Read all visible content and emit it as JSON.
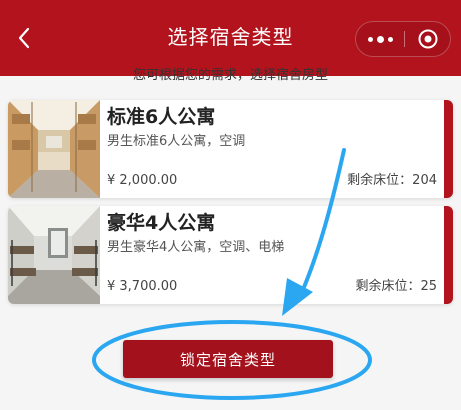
{
  "header": {
    "title": "选择宿舍类型",
    "back_icon": "chevron-left-icon",
    "more_icon": "more-dots-icon",
    "close_icon": "target-circle-icon",
    "background_color": "#b2131c"
  },
  "subtitle": "您可根据您的需求，选择宿舍房型",
  "rooms": [
    {
      "name": "标准6人公寓",
      "desc": "男生标准6人公寓，空调",
      "price": "¥ 2,000.00",
      "beds": "剩余床位：204"
    },
    {
      "name": "豪华4人公寓",
      "desc": "男生豪华4人公寓，空调、电梯",
      "price": "¥ 3,700.00",
      "beds": "剩余床位：25"
    }
  ],
  "lock_button_label": "锁定宿舍类型",
  "accent_color": "#b2131c",
  "annotation_color": "#2aa7f0"
}
